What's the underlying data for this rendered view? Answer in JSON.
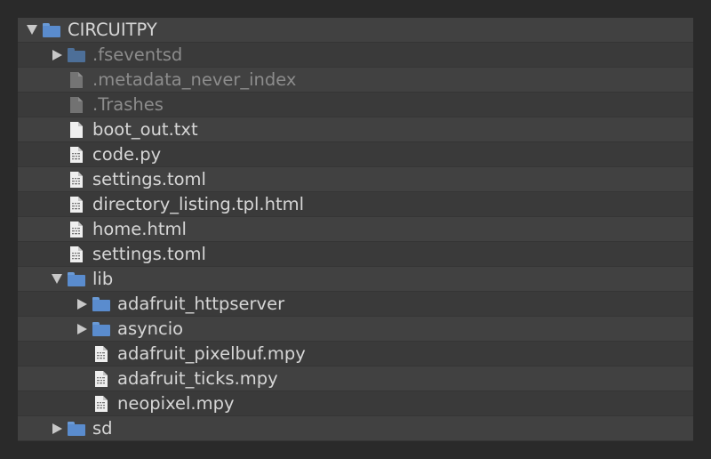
{
  "tree": {
    "items": [
      {
        "name": "CIRCUITPY",
        "kind": "folder",
        "depth": 0,
        "toggle": "expanded",
        "dim": false,
        "icon": "folder-icon"
      },
      {
        "name": ".fseventsd",
        "kind": "folder",
        "depth": 1,
        "toggle": "collapsed",
        "dim": true,
        "icon": "folder-icon"
      },
      {
        "name": ".metadata_never_index",
        "kind": "file",
        "depth": 1,
        "toggle": "none",
        "dim": true,
        "icon": "gray-file-icon"
      },
      {
        "name": ".Trashes",
        "kind": "file",
        "depth": 1,
        "toggle": "none",
        "dim": true,
        "icon": "gray-file-icon"
      },
      {
        "name": "boot_out.txt",
        "kind": "file",
        "depth": 1,
        "toggle": "none",
        "dim": false,
        "icon": "text-file-icon"
      },
      {
        "name": "code.py",
        "kind": "file",
        "depth": 1,
        "toggle": "none",
        "dim": false,
        "icon": "code-file-icon"
      },
      {
        "name": "settings.toml",
        "kind": "file",
        "depth": 1,
        "toggle": "none",
        "dim": false,
        "icon": "code-file-icon"
      },
      {
        "name": "directory_listing.tpl.html",
        "kind": "file",
        "depth": 1,
        "toggle": "none",
        "dim": false,
        "icon": "code-file-icon"
      },
      {
        "name": "home.html",
        "kind": "file",
        "depth": 1,
        "toggle": "none",
        "dim": false,
        "icon": "code-file-icon"
      },
      {
        "name": "settings.toml",
        "kind": "file",
        "depth": 1,
        "toggle": "none",
        "dim": false,
        "icon": "code-file-icon"
      },
      {
        "name": "lib",
        "kind": "folder",
        "depth": 1,
        "toggle": "expanded",
        "dim": false,
        "icon": "folder-icon"
      },
      {
        "name": "adafruit_httpserver",
        "kind": "folder",
        "depth": 2,
        "toggle": "collapsed",
        "dim": false,
        "icon": "folder-icon"
      },
      {
        "name": "asyncio",
        "kind": "folder",
        "depth": 2,
        "toggle": "collapsed",
        "dim": false,
        "icon": "folder-icon"
      },
      {
        "name": "adafruit_pixelbuf.mpy",
        "kind": "file",
        "depth": 2,
        "toggle": "none",
        "dim": false,
        "icon": "code-file-icon"
      },
      {
        "name": "adafruit_ticks.mpy",
        "kind": "file",
        "depth": 2,
        "toggle": "none",
        "dim": false,
        "icon": "code-file-icon"
      },
      {
        "name": "neopixel.mpy",
        "kind": "file",
        "depth": 2,
        "toggle": "none",
        "dim": false,
        "icon": "code-file-icon"
      },
      {
        "name": "sd",
        "kind": "folder",
        "depth": 1,
        "toggle": "collapsed",
        "dim": false,
        "icon": "folder-icon"
      }
    ]
  },
  "colors": {
    "page_background": "#2a2a2a",
    "panel_background": "#3a3a3a",
    "row_alt_background": "#414141",
    "text": "#d6d6d6",
    "text_dim": "#8c8c8c",
    "folder": "#5a8cce"
  }
}
